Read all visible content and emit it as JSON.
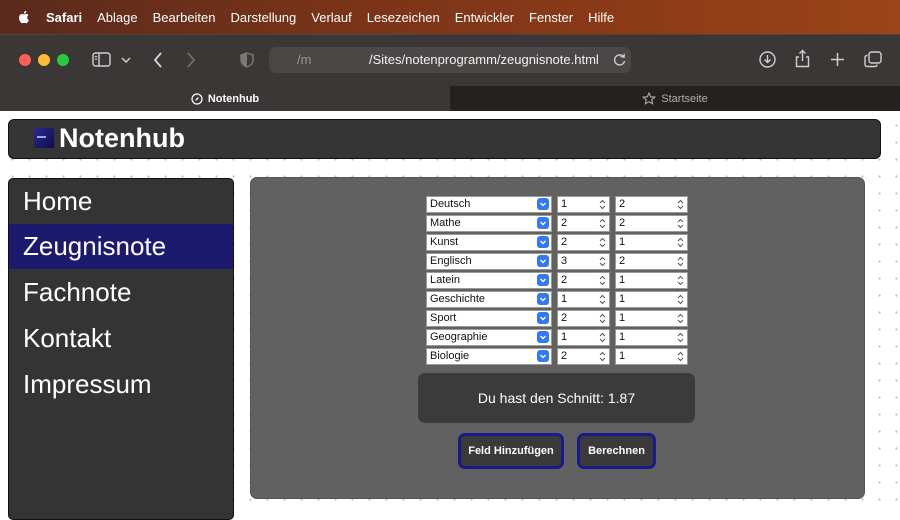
{
  "menubar": {
    "app": "Safari",
    "items": [
      "Ablage",
      "Bearbeiten",
      "Darstellung",
      "Verlauf",
      "Lesezeichen",
      "Entwickler",
      "Fenster",
      "Hilfe"
    ]
  },
  "toolbar": {
    "url_prefix": "/m",
    "url": "/Sites/notenprogramm/zeugnisnote.html"
  },
  "tabs": [
    {
      "label": "Notenhub",
      "active": true
    },
    {
      "label": "Startseite",
      "active": false
    }
  ],
  "site": {
    "title": "Notenhub"
  },
  "nav": {
    "items": [
      "Home",
      "Zeugnisnote",
      "Fachnote",
      "Kontakt",
      "Impressum"
    ],
    "active_index": 1
  },
  "grades": {
    "rows": [
      {
        "subject": "Deutsch",
        "a": "1",
        "b": "2"
      },
      {
        "subject": "Mathe",
        "a": "2",
        "b": "2"
      },
      {
        "subject": "Kunst",
        "a": "2",
        "b": "1"
      },
      {
        "subject": "Englisch",
        "a": "3",
        "b": "2"
      },
      {
        "subject": "Latein",
        "a": "2",
        "b": "1"
      },
      {
        "subject": "Geschichte",
        "a": "1",
        "b": "1"
      },
      {
        "subject": "Sport",
        "a": "2",
        "b": "1"
      },
      {
        "subject": "Geographie",
        "a": "1",
        "b": "1"
      },
      {
        "subject": "Biologie",
        "a": "2",
        "b": "1"
      }
    ]
  },
  "result": {
    "text": "Du hast den Schnitt: 1.87"
  },
  "buttons": {
    "add_field": "Feld Hinzufügen",
    "calculate": "Berechnen"
  },
  "colors": {
    "nav_active": "#1c1a6e",
    "button_border": "#1a1a8a",
    "select_chevron": "#3478f6"
  }
}
